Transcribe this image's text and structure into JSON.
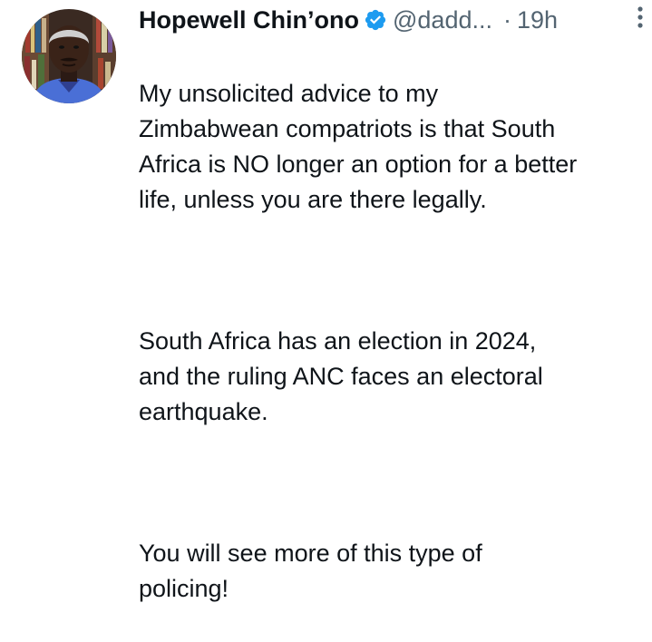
{
  "author": {
    "name": "Hopewell Chin’ono",
    "handle": "@dadd...",
    "separator": "·",
    "time": "19h"
  },
  "icons": {
    "verified": "verified-badge-icon",
    "more": "more-options-icon",
    "accent_color": "#1d9bf0"
  },
  "tweet": {
    "paragraphs": [
      "My unsolicited advice to my\nZimbabwean compatriots is that South\nAfrica is NO longer an option for a better\nlife, unless you are there legally.",
      "South Africa has an election in 2024,\nand the ruling ANC faces an electoral\nearthquake.",
      "You will see more of this type of\npolicing!"
    ]
  }
}
